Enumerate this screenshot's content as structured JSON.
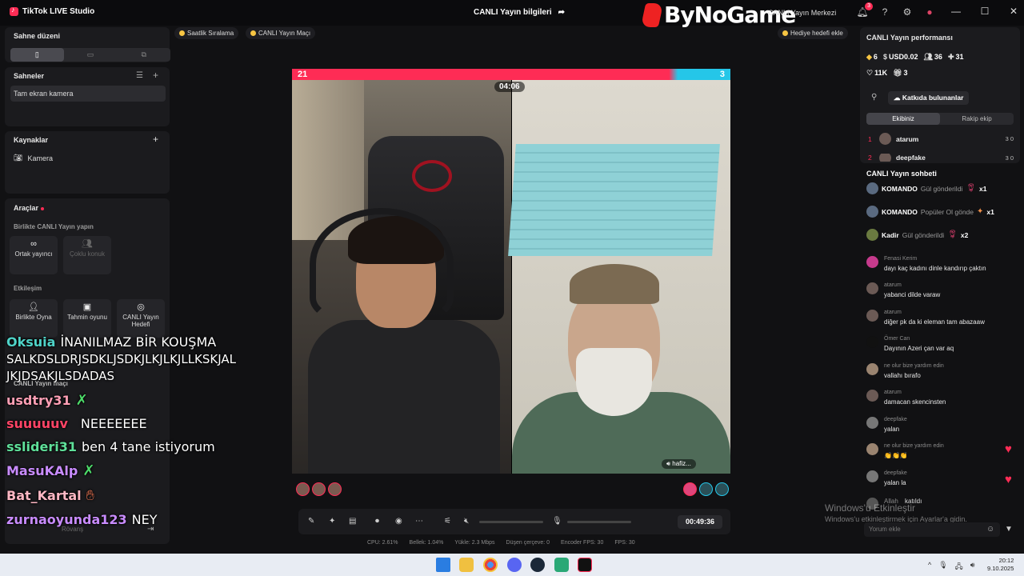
{
  "app": {
    "title": "TikTok LIVE Studio"
  },
  "header": {
    "live_info": "CANLI Yayın bilgileri",
    "watermark": "ByNoGame",
    "center_link": "CANLI Yayın Merkezi",
    "notification_count": "3"
  },
  "left": {
    "scene_layout": {
      "title": "Sahne düzeni"
    },
    "scenes": {
      "title": "Sahneler",
      "item": "Tam ekran kamera"
    },
    "sources": {
      "title": "Kaynaklar",
      "item": "Kamera"
    },
    "tools": {
      "title": "Araçlar",
      "together_title": "Birlikte CANLI Yayın yapın",
      "cohost": "Ortak yayıncı",
      "multi_guest": "Çoklu konuk",
      "engagement_title": "Etkileşim",
      "play_together": "Birlikte Oyna",
      "prediction": "Tahmin oyunu",
      "live_goal": "CANLI Yayın Hedefi",
      "live_match": "CANLI Yayın maçı",
      "rovans": "Rövanş"
    }
  },
  "chips": {
    "hourly": "Saatlik Sıralama",
    "live_match": "CANLI Yayın Maçı",
    "gift_goal": "Hediye hedefi ekle"
  },
  "video": {
    "score_left": "21",
    "score_right": "3",
    "timer": "04:06",
    "guest_tag": "hafiz..."
  },
  "controls": {
    "duration": "00:49:36"
  },
  "stats": {
    "cpu": "CPU: 2.61%",
    "memory": "Bellek: 1.04%",
    "upload": "Yükle: 2.3 Mbps",
    "frame_drop": "Düşen çerçeve: 0",
    "encoder_fps": "Encoder FPS: 30",
    "fps": "FPS: 30"
  },
  "perf": {
    "title": "CANLI Yayın performansı",
    "diamonds": "6",
    "usd": "USD0.02",
    "viewers": "36",
    "new_followers": "31",
    "likes": "11K",
    "gifts": "3",
    "contributors_button": "Katkıda bulunanlar",
    "team_tab": "Ekibiniz",
    "rival_tab": "Rakip ekip",
    "ranking": [
      {
        "rank": "1",
        "name": "atarum",
        "stat": "3  0"
      },
      {
        "rank": "2",
        "name": "deepfake",
        "stat": "3  0"
      }
    ]
  },
  "chat": {
    "title": "CANLI Yayın sohbeti",
    "gifts": [
      {
        "user": "KOMANDO",
        "text": "Gül gönderildi",
        "count": "x1"
      },
      {
        "user": "KOMANDO",
        "text": "Popüler Ol gönde",
        "count": "x1"
      },
      {
        "user": "Kadir",
        "text": "Gül gönderildi",
        "count": "x2"
      }
    ],
    "messages": [
      {
        "user": "Fenasi Kerim",
        "text": "dayı kaç kadını dinle kandırıp çaktın"
      },
      {
        "user": "atarum",
        "text": "yabanci dilde varaw"
      },
      {
        "user": "atarum",
        "text": "diğer pk da ki eleman tam abazaaw"
      },
      {
        "user": "Ömer Can",
        "text": "Dayının Azeri çan var aq"
      },
      {
        "user": "ne olur bize yardım edin",
        "text": "vallahı bırafo"
      },
      {
        "user": "atarum",
        "text": "damacan skencinsten"
      },
      {
        "user": "deepfake",
        "text": "yalan"
      },
      {
        "user": "ne olur bize yardım edin",
        "text": "👏👏👏"
      },
      {
        "user": "deepfake",
        "text": "yalan la"
      },
      {
        "user": "Allah",
        "text": "katıldı"
      }
    ],
    "input_placeholder": "Yorum ekle"
  },
  "windows_watermark": {
    "line1": "Windows'u Etkinleştir",
    "line2": "Windows'u etkinleştirmek için Ayarlar'a gidin."
  },
  "overlay": [
    {
      "user": "Oksuia",
      "color": "#4fd3c8",
      "text": "İNANILMAZ BİR KOUŞMA"
    },
    {
      "user": "",
      "color": "#ffffff",
      "text": "SALKDSLDRJSDKLJSDKJLKJLKJLLKSKJAL"
    },
    {
      "user": "",
      "color": "#ffffff",
      "text": "JKJDSAKJLSDADAS"
    },
    {
      "user": "usdtry31",
      "color": "#ff9fb5",
      "text": ""
    },
    {
      "user": "suuuuuv",
      "color": "#ff4466",
      "text": "NEEEEEEE"
    },
    {
      "user": "sslideri31",
      "color": "#5fe09a",
      "text": "ben 4 tane istiyorum"
    },
    {
      "user": "MasuKAlp",
      "color": "#c98cff",
      "text": ""
    },
    {
      "user": "Bat_Kartal",
      "color": "#ffb8c4",
      "text": ""
    },
    {
      "user": "zurnaoyunda123",
      "color": "#c98cff",
      "text": "NEY"
    }
  ],
  "taskbar": {
    "time": "20:12",
    "date": "9.10.2025"
  }
}
